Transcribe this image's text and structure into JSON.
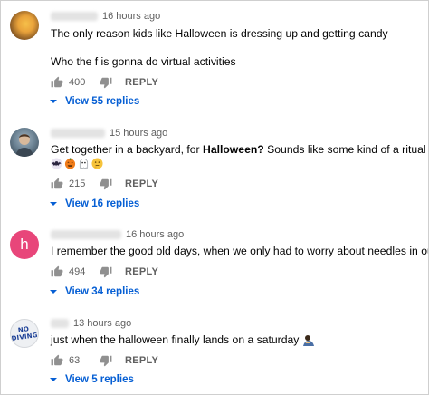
{
  "accent_color": "#065fd4",
  "comments": [
    {
      "time": "16 hours ago",
      "lines": [
        "The only reason kids like Halloween is dressing up and getting candy",
        "",
        "Who the f is gonna do virtual activities"
      ],
      "likes": "400",
      "reply_label": "REPLY",
      "view_replies": "View 55 replies"
    },
    {
      "time": "15 hours ago",
      "text_before": "Get together in a backyard, for ",
      "text_bold": "Halloween?",
      "text_after": " Sounds like some kind of a ritual to me...",
      "emoji_icons": [
        "bat-emoji",
        "jack-o-lantern-emoji",
        "ghost-emoji",
        "thinking-face-emoji"
      ],
      "likes": "215",
      "reply_label": "REPLY",
      "view_replies": "View 16 replies"
    },
    {
      "avatar_letter": "h",
      "avatar_color": "#e8467a",
      "time": "16 hours ago",
      "text": "I remember the good old days, when we only had to worry about needles in our candy.",
      "likes": "494",
      "reply_label": "REPLY",
      "view_replies": "View 34 replies"
    },
    {
      "avatar_logo": "NO DIVING",
      "time": "13 hours ago",
      "text": "just when the halloween finally lands on a saturday",
      "emoji_icon": "person-bowing-emoji",
      "likes": "63",
      "reply_label": "REPLY",
      "view_replies": "View 5 replies"
    }
  ]
}
